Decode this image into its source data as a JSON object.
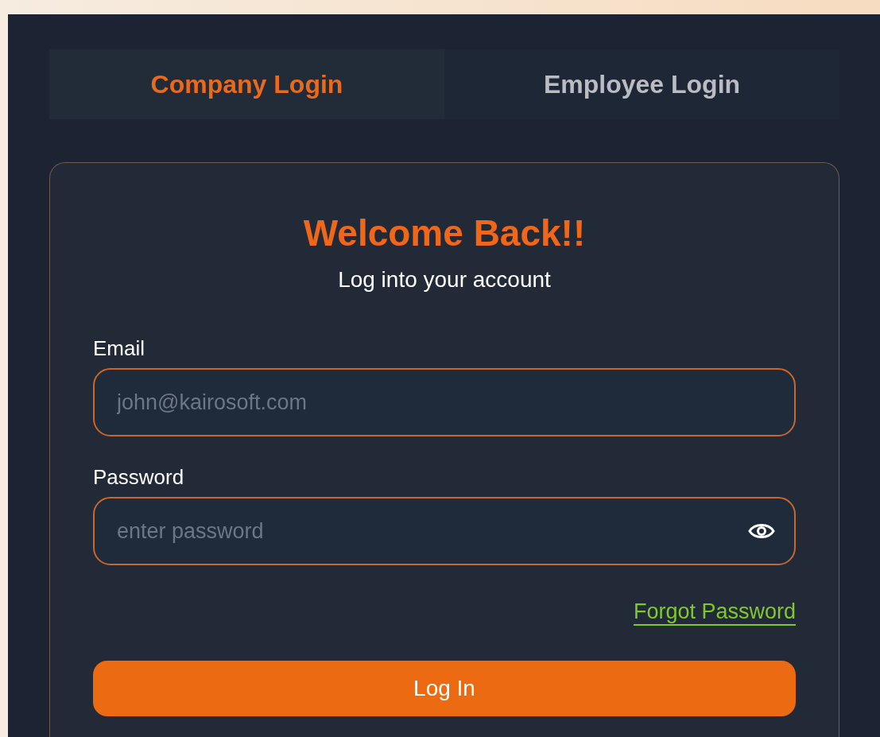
{
  "tabs": [
    {
      "label": "Company Login",
      "selected": true
    },
    {
      "label": "Employee Login",
      "selected": false
    }
  ],
  "card": {
    "title": "Welcome Back!!",
    "subtitle": "Log into your account",
    "fields": [
      {
        "kind": "text",
        "label": "Email",
        "placeholder": "john@kairosoft.com"
      },
      {
        "kind": "password",
        "label": "Password",
        "placeholder": "enter password"
      }
    ],
    "forgot_link": "Forgot Password",
    "submit": "Log In"
  }
}
